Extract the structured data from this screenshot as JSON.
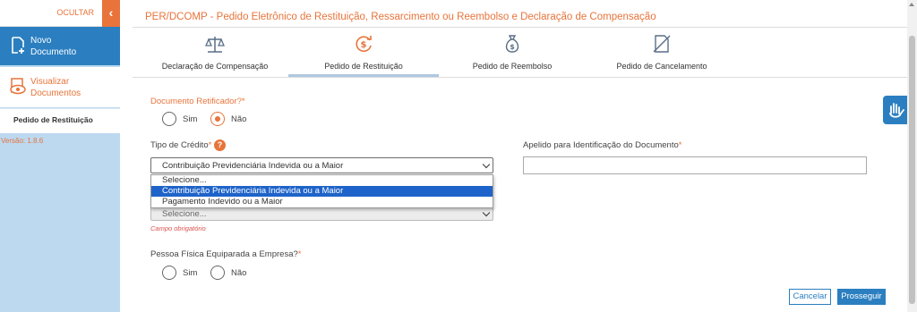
{
  "sidebar": {
    "hide_label": "OCULTAR",
    "hide_button": "‹",
    "new_document": [
      "Novo",
      "Documento"
    ],
    "view_documents": [
      "Visualizar",
      "Documentos"
    ],
    "current_item": "Pedido de Restituição",
    "version": "Versão: 1.8.6"
  },
  "header": {
    "title": "PER/DCOMP - Pedido Eletrônico de Restituição, Ressarcimento ou Reembolso e Declaração de Compensação"
  },
  "tabs": [
    {
      "label": "Declaração de Compensação",
      "icon": "scales-icon",
      "active": false
    },
    {
      "label": "Pedido de Restituição",
      "icon": "refund-icon",
      "active": true
    },
    {
      "label": "Pedido de Reembolso",
      "icon": "money-bag-icon",
      "active": false
    },
    {
      "label": "Pedido de Cancelamento",
      "icon": "cancel-doc-icon",
      "active": false
    }
  ],
  "form": {
    "retificador_label": "Documento Retificador?",
    "required_mark": "*",
    "yes": "Sim",
    "no": "Não",
    "retificador_value": "Não",
    "tipo_credito_label": "Tipo de Crédito",
    "help": "?",
    "tipo_credito_value": "Contribuição Previdenciária Indevida ou a Maior",
    "tipo_credito_options": [
      "Selecione...",
      "Contribuição Previdenciária Indevida ou a Maior",
      "Pagamento Indevido ou a Maior"
    ],
    "apelido_label": "Apelido para Identificação do Documento",
    "apelido_value": "",
    "second_select_value": "Selecione...",
    "error_text": "Campo obrigatório",
    "pessoa_fisica_label": "Pessoa Física Equiparada a Empresa?",
    "pessoa_fisica_value": ""
  },
  "actions": {
    "cancel": "Cancelar",
    "next": "Prosseguir"
  },
  "colors": {
    "accent": "#e8743b",
    "primary": "#2b7fc0",
    "sidebar": "#bcd9f0",
    "selection": "#1e63c9"
  }
}
